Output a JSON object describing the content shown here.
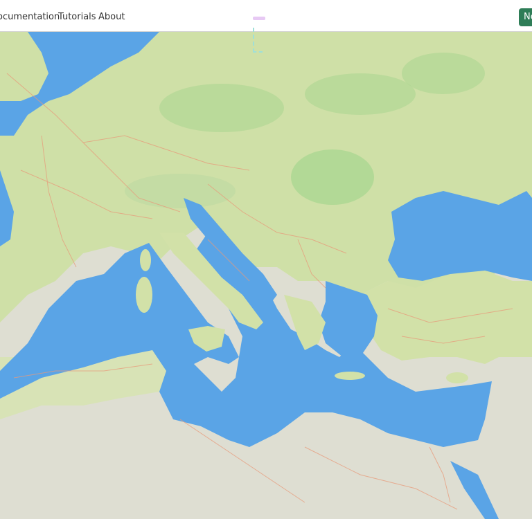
{
  "nav": {
    "links": [
      "Documentation",
      "Tutorials",
      "About"
    ],
    "button_label": "New"
  },
  "map": {
    "region": "Mediterranean basin",
    "colors": {
      "sea": "#5aa4e6",
      "land_north": "#cfe0a7",
      "land_desert": "#deded2",
      "forest": "#9fd38a",
      "roads": "#e89a7a"
    }
  }
}
